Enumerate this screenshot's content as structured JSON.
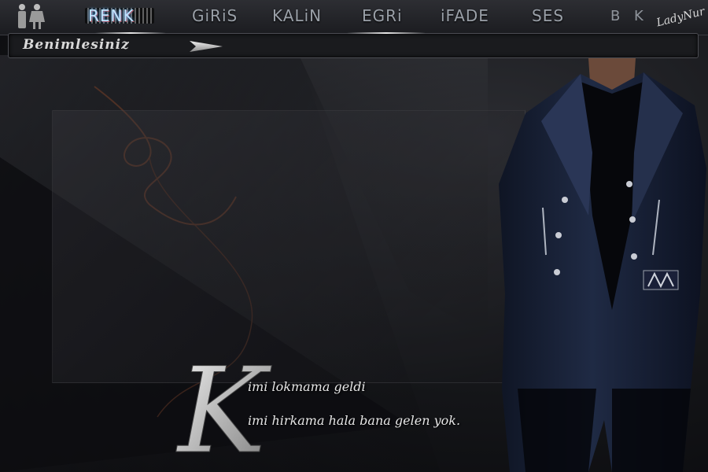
{
  "toolbar": {
    "items": [
      {
        "label": "RENK"
      },
      {
        "label": "GiRiS"
      },
      {
        "label": "KALiN"
      },
      {
        "label": "EGRi"
      },
      {
        "label": "iFADE"
      },
      {
        "label": "SES"
      },
      {
        "label": "B"
      },
      {
        "label": "K"
      }
    ],
    "signature": "LadyNur"
  },
  "input": {
    "value": "Benimlesiniz"
  },
  "poem": {
    "initial": "K",
    "line1": "imi lokmama geldi",
    "line2": "imi hirkama hala bana gelen yok."
  },
  "colors": {
    "background": "#141518",
    "coat": "#1b2236",
    "accent_renk": "#bfe4ff"
  }
}
